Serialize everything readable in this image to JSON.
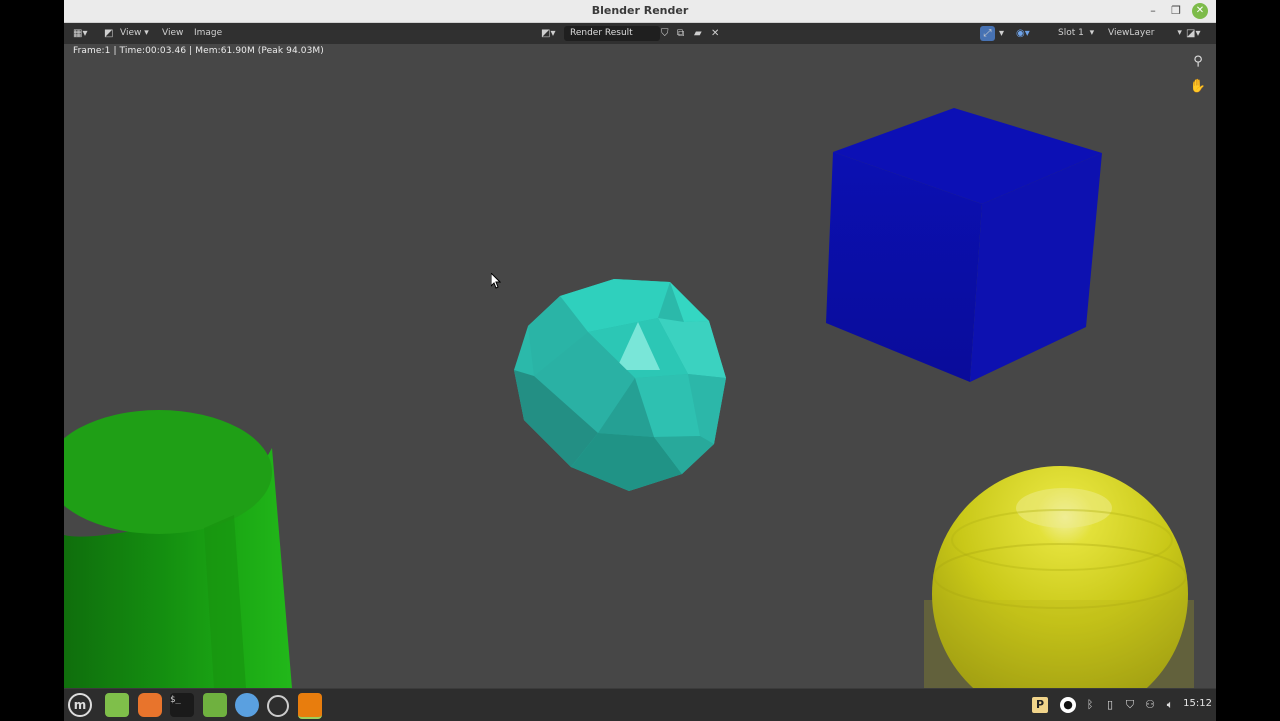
{
  "window": {
    "title": "Blender Render"
  },
  "header": {
    "menus": [
      "View",
      "View",
      "Image"
    ],
    "image_name": "Render Result",
    "slot": "Slot 1",
    "view_layer": "ViewLayer"
  },
  "stats": "Frame:1 | Time:00:03.46 | Mem:61.90M (Peak 94.03M)",
  "taskbar": {
    "apps": [
      "menu-icon",
      "files-icon",
      "firefox-icon",
      "terminal-icon",
      "folder-icon",
      "chromium-icon",
      "obs-icon",
      "blender-icon"
    ],
    "clock": "15:12"
  },
  "colors": {
    "viewport_bg": "#474747",
    "header_bg": "#303030",
    "cube": "#0b0fa8",
    "icosphere": "#2ec4b4",
    "cylinder": "#1fa314",
    "uv_sphere": "#cfcd1a",
    "taskbar_bg": "#2d2d2d"
  }
}
